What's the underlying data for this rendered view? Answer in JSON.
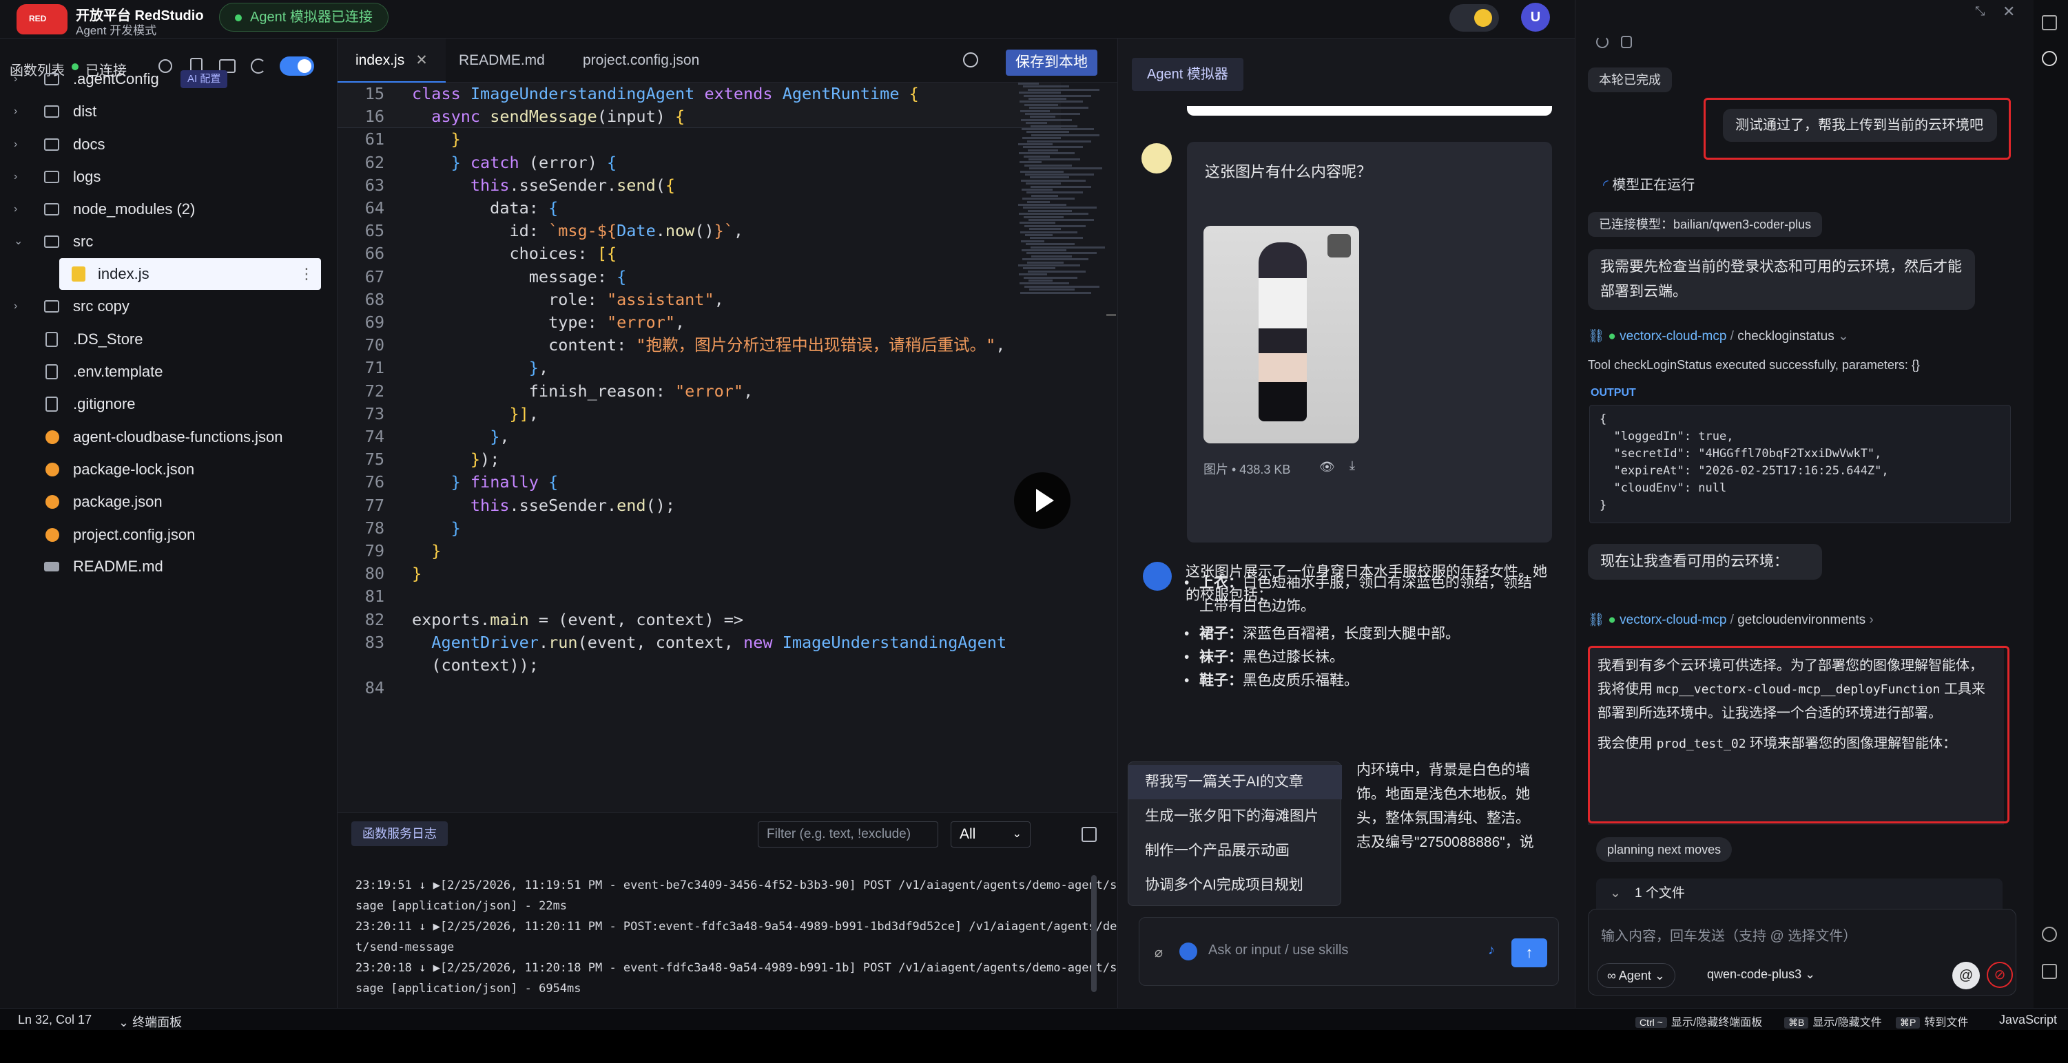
{
  "header": {
    "brand_title": "开放平台 RedStudio",
    "brand_subtitle": "Agent 开发模式",
    "logo_text": "RED",
    "conn_status": "Agent 模拟器已连接",
    "user_initial": "U"
  },
  "files": {
    "title": "函数列表",
    "status": "已连接",
    "items": [
      {
        "name": ".agentConfig",
        "tag": "AI 配置",
        "kind": "folder"
      },
      {
        "name": "dist",
        "kind": "folder"
      },
      {
        "name": "docs",
        "kind": "folder"
      },
      {
        "name": "logs",
        "kind": "folder"
      },
      {
        "name": "node_modules (2)",
        "kind": "folder"
      },
      {
        "name": "src",
        "kind": "folder-open"
      },
      {
        "name": "index.js",
        "kind": "selected"
      },
      {
        "name": "src copy",
        "kind": "folder"
      },
      {
        "name": ".DS_Store",
        "kind": "file"
      },
      {
        "name": ".env.template",
        "kind": "file"
      },
      {
        "name": ".gitignore",
        "kind": "file"
      },
      {
        "name": "agent-cloudbase-functions.json",
        "kind": "json"
      },
      {
        "name": "package-lock.json",
        "kind": "json"
      },
      {
        "name": "package.json",
        "kind": "json"
      },
      {
        "name": "project.config.json",
        "kind": "json"
      },
      {
        "name": "README.md",
        "kind": "md"
      }
    ]
  },
  "editor": {
    "tabs": [
      "index.js",
      "README.md",
      "project.config.json"
    ],
    "save_label": "保存到本地",
    "lines": [
      {
        "n": "15",
        "html": "<span class='k'>class</span> <span class='p'>ImageUnderstandingAgent</span> <span class='k'>extends</span> <span class='p'>AgentRuntime</span> <span class='y'>{</span>"
      },
      {
        "n": "16",
        "html": "  <span class='k'>async</span> <span class='f'>sendMessage</span>(input) <span class='y'>{</span>"
      },
      {
        "n": "61",
        "html": "    <span class='y'>}</span>"
      },
      {
        "n": "62",
        "html": "    <span class='b'>}</span> <span class='k'>catch</span> (error) <span class='b'>{</span>"
      },
      {
        "n": "63",
        "html": "      <span class='k'>this</span>.sseSender.<span class='f'>send</span>(<span class='y'>{</span>"
      },
      {
        "n": "64",
        "html": "        data: <span class='b'>{</span>"
      },
      {
        "n": "65",
        "html": "          id: <span class='s'>`msg-${</span><span class='p'>Date</span>.<span class='f'>now</span>()<span class='s'>}`</span>,"
      },
      {
        "n": "66",
        "html": "          choices: <span class='y'>[{</span>"
      },
      {
        "n": "67",
        "html": "            message: <span class='b'>{</span>"
      },
      {
        "n": "68",
        "html": "              role: <span class='s'>\"assistant\"</span>,"
      },
      {
        "n": "69",
        "html": "              type: <span class='s'>\"error\"</span>,"
      },
      {
        "n": "70",
        "html": "              content: <span class='s'>\"抱歉，图片分析过程中出现错误，请稍后重试。\"</span>,"
      },
      {
        "n": "71",
        "html": "            <span class='b'>}</span>,"
      },
      {
        "n": "72",
        "html": "            finish_reason: <span class='s'>\"error\"</span>,"
      },
      {
        "n": "73",
        "html": "          <span class='y'>}]</span>,"
      },
      {
        "n": "74",
        "html": "        <span class='b'>}</span>,"
      },
      {
        "n": "75",
        "html": "      <span class='y'>}</span>);"
      },
      {
        "n": "76",
        "html": "    <span class='b'>}</span> <span class='k'>finally</span> <span class='b'>{</span>"
      },
      {
        "n": "77",
        "html": "      <span class='k'>this</span>.sseSender.<span class='f'>end</span>();"
      },
      {
        "n": "78",
        "html": "    <span class='b'>}</span>"
      },
      {
        "n": "79",
        "html": "  <span class='y'>}</span>"
      },
      {
        "n": "80",
        "html": "<span class='y'>}</span>"
      },
      {
        "n": "81",
        "html": ""
      },
      {
        "n": "82",
        "html": "exports.<span class='f'>main</span> = (event, context) =>"
      },
      {
        "n": "83",
        "html": "  <span class='p'>AgentDriver</span>.<span class='f'>run</span>(event, context, <span class='k'>new</span> <span class='p'>ImageUnderstandingAgent</span>"
      },
      {
        "n": "",
        "html": "  (context));"
      },
      {
        "n": "84",
        "html": ""
      }
    ]
  },
  "logs": {
    "tab": "函数服务日志",
    "filter_placeholder": "Filter (e.g. text, !exclude)",
    "level": "All",
    "lines": [
      "23:19:51 ↓ ▶[2/25/2026, 11:19:51 PM - event-be7c3409-3456-4f52-b3b3-90] POST /v1/aiagent/agents/demo-agent/send-mes",
      "sage [application/json] - 22ms",
      "23:20:11 ↓ ▶[2/25/2026, 11:20:11 PM - POST:event-fdfc3a48-9a54-4989-b991-1bd3df9d52ce] /v1/aiagent/agents/demo-agen",
      "t/send-message",
      "23:20:18 ↓ ▶[2/25/2026, 11:20:18 PM - event-fdfc3a48-9a54-4989-b991-1b] POST /v1/aiagent/agents/demo-agent/send-mes",
      "sage [application/json] - 6954ms"
    ]
  },
  "simulator": {
    "tab": "Agent 模拟器",
    "user_question": "这张图片有什么内容呢？",
    "image_meta": "图片 • 438.3 KB",
    "ai_intro": "这张图片展示了一位身穿日本水手服校服的年轻女性。她的校服包括：",
    "bullets": [
      {
        "label": "上衣：",
        "text": "白色短袖水手服，领口有深蓝色的领结，领结上带有白色边饰。"
      },
      {
        "label": "裙子：",
        "text": "深蓝色百褶裙，长度到大腿中部。"
      },
      {
        "label": "袜子：",
        "text": "黑色过膝长袜。"
      },
      {
        "label": "鞋子：",
        "text": "黑色皮质乐福鞋。"
      }
    ],
    "partial_lines": [
      "内环境中，背景是白色的墙",
      "饰。地面是浅色木地板。她",
      "头，整体氛围清纯、整洁。",
      "志及编号\"2750088886\"，说"
    ],
    "suggestions": [
      "帮我写一篇关于AI的文章",
      "生成一张夕阳下的海滩图片",
      "制作一个产品展示动画",
      "协调多个AI完成项目规划"
    ],
    "input_placeholder": "Ask or input / use skills"
  },
  "chat": {
    "round_done": "本轮已完成",
    "user_msg": "测试通过了，帮我上传到当前的云环境吧",
    "model_running": "模型正在运行",
    "connected_model": "已连接模型：bailian/qwen3-coder-plus",
    "msg1": "我需要先检查当前的登录状态和可用的云环境，然后才能部署到云端。",
    "mcp_name": "vectorx-cloud-mcp",
    "tool1": "checkloginstatus",
    "tool1_result": "Tool checkLoginStatus executed successfully, parameters: {}",
    "output_label": "OUTPUT",
    "output_json": "{\n  \"loggedIn\": true,\n  \"secretId\": \"4HGGffl70bqF2TxxiDwVwkT\",\n  \"expireAt\": \"2026-02-25T17:16:25.644Z\",\n  \"cloudEnv\": null\n}",
    "msg2": "现在让我查看可用的云环境：",
    "tool2": "getcloudenvironments",
    "msg3_a": "我看到有多个云环境可供选择。为了部署您的图像理解智能体，我将使用",
    "msg3_code": "mcp__vectorx-cloud-mcp__deployFunction",
    "msg3_b": "工具来部署到所选环境中。让我选择一个合适的环境进行部署。",
    "msg4_a": "我会使用",
    "msg4_code": "prod_test_02",
    "msg4_b": "环境来部署您的图像理解智能体：",
    "planning": "planning next moves",
    "files_label": "1 个文件",
    "input_placeholder": "输入内容，回车发送（支持 @ 选择文件）",
    "agent_mode": "Agent",
    "model": "qwen-code-plus3"
  },
  "status": {
    "position": "Ln 32, Col 17",
    "terminal": "终端面板",
    "k1": "Ctrl ~",
    "a1": "显示/隐藏终端面板",
    "k2": "⌘B",
    "a2": "显示/隐藏文件",
    "k3": "⌘P",
    "a3": "转到文件",
    "lang": "JavaScript"
  }
}
